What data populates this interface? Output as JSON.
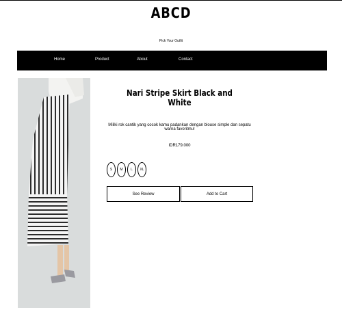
{
  "header": {
    "brand": "ABCD",
    "tagline": "Pick Your Outfit"
  },
  "nav": {
    "items": [
      "Home",
      "Product",
      "About",
      "Contact"
    ]
  },
  "product": {
    "title": "Nari Stripe Skirt Black and White",
    "description": "Miliki rok cantik yang cocok kamu padankan dengan blouse simple dan sepatu warna favoritmu!",
    "price": "IDR179.000",
    "sizes": [
      "S",
      "M",
      "L",
      "XL"
    ],
    "buttons": {
      "review": "See Review",
      "cart": "Add to Cart"
    }
  }
}
